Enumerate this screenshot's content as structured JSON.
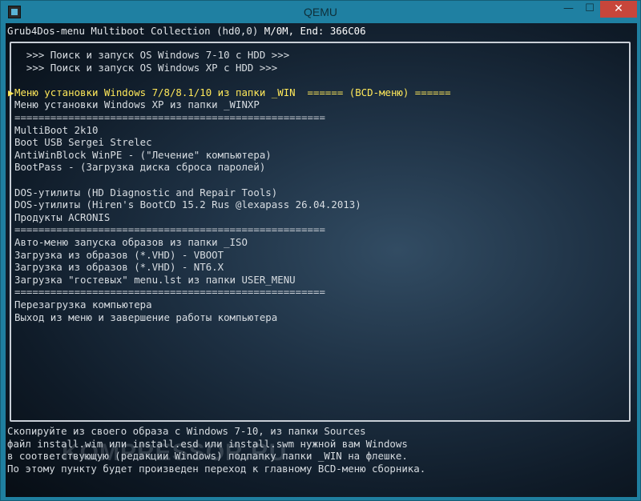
{
  "window": {
    "title": "QEMU",
    "controls": {
      "minimize": "—",
      "maximize": "☐",
      "close": "✕"
    }
  },
  "screen": {
    "header_left": "Grub4Dos-menu Multiboot Collection (hd0,0) ",
    "header_right": "M/0M, End: 366C06",
    "selection_marker": "▶",
    "menu": [
      "  >>> Поиск и запуск OS Windows 7-10 с HDD >>>",
      "  >>> Поиск и запуск OS Windows XP с HDD >>>",
      "",
      "Меню установки Windows 7/8/8.1/10 из папки _WIN  ====== (BCD-меню) ======",
      "Меню установки Windows XP из папки _WINXP",
      "====================================================",
      "MultiBoot 2k10",
      "Boot USB Sergei Strelec",
      "AntiWinBlock WinPE - (\"Лечение\" компьютера)",
      "BootPass - (Загрузка диска сброса паролей)",
      "",
      "DOS-утилиты (HD Diagnostic and Repair Tools)",
      "DOS-утилиты (Hiren's BootCD 15.2 Rus @lexapass 26.04.2013)",
      "Продукты ACRONIS",
      "====================================================",
      "Авто-меню запуска образов из папки _ISO",
      "Загрузка из образов (*.VHD) - VBOOT",
      "Загрузка из образов (*.VHD) - NT6.X",
      "Загрузка \"гостевых\" menu.lst из папки USER_MENU",
      "====================================================",
      "Перезагрузка компьютера",
      "Выход из меню и завершение работы компьютера"
    ],
    "selected_index": 3,
    "footer": [
      "Скопируйте из своего образа с Windows 7-10, из папки Sources",
      "файл install.wim или install.esd или install.swm нужной вам Windows",
      "в соответствующую (редакции Windows) подпапку папки _WIN на флешке.",
      "По этому пункту будет произведен переход к главному BCD-меню сборника."
    ],
    "watermark": "KOMPRESSOR.RU"
  }
}
